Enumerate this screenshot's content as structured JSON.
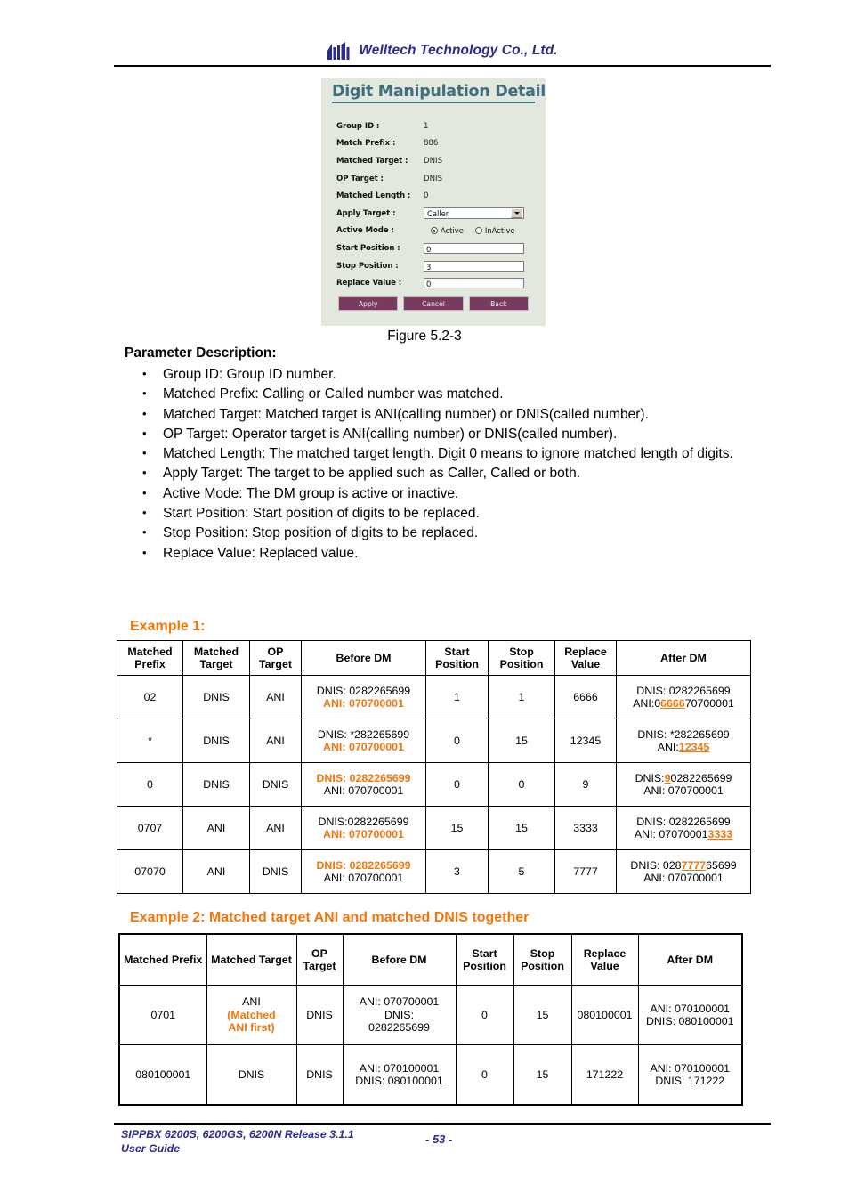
{
  "header": {
    "company": "Welltech Technology Co., Ltd.",
    "logo_icon": "welltech-logo-icon"
  },
  "panel": {
    "title": "Digit Manipulation Detail",
    "fields": [
      {
        "label": "Group ID :",
        "value": "1",
        "type": "static"
      },
      {
        "label": "Match Prefix :",
        "value": "886",
        "type": "static"
      },
      {
        "label": "Matched Target :",
        "value": "DNIS",
        "type": "static"
      },
      {
        "label": "OP Target :",
        "value": "DNIS",
        "type": "static"
      },
      {
        "label": "Matched Length :",
        "value": "0",
        "type": "static"
      }
    ],
    "apply_target": {
      "label": "Apply Target :",
      "value": "Caller"
    },
    "active_mode": {
      "label": "Active Mode :",
      "option_active": "Active",
      "option_inactive": "InActive",
      "selected": "Active"
    },
    "start_position": {
      "label": "Start Position :",
      "value": "0"
    },
    "stop_position": {
      "label": "Stop Position :",
      "value": "3"
    },
    "replace_value": {
      "label": "Replace Value :",
      "value": "0"
    },
    "buttons": {
      "apply": "Apply",
      "cancel": "Cancel",
      "back": "Back"
    },
    "colors": {
      "background": "#e2e8dd",
      "title": "#3f6f7c",
      "button": "#7a3a5f"
    }
  },
  "figure": {
    "caption": "Figure 5.2-3"
  },
  "parameters": {
    "heading": "Parameter Description:",
    "items": [
      "Group ID: Group ID number.",
      "Matched Prefix: Calling or Called number was matched.",
      "Matched Target: Matched target is ANI(calling number) or DNIS(called number).",
      "OP Target: Operator target is ANI(calling number) or DNIS(called number).",
      "Matched Length: The matched target length. Digit 0 means to ignore matched length of digits.",
      "Apply Target: The target to be applied such as Caller, Called or both.",
      "Active Mode: The DM group is active or inactive.",
      "Start Position: Start position of digits to be replaced.",
      "Stop Position: Stop position of digits to be replaced.",
      "Replace Value: Replaced value."
    ]
  },
  "example1": {
    "heading": "Example 1:",
    "accent_color": "#f4760a",
    "columns": [
      "Matched Prefix",
      "Matched Target",
      "OP Target",
      "Before DM",
      "Start Position",
      "Stop Position",
      "Replace Value",
      "After DM"
    ],
    "rows": [
      {
        "matched_prefix": "02",
        "matched_target": "DNIS",
        "op_target": "ANI",
        "before_dm": {
          "line1": "DNIS: 0282265699",
          "line2": "ANI: 070700001",
          "highlight": "line2"
        },
        "start_position": "1",
        "stop_position": "1",
        "replace_value": "6666",
        "after_dm": {
          "line1": "DNIS: 0282265699",
          "line2_pre": "ANI:0",
          "line2_hl": "6666",
          "line2_post": "70700001"
        }
      },
      {
        "matched_prefix": "*",
        "matched_target": "DNIS",
        "op_target": "ANI",
        "before_dm": {
          "line1": "DNIS: *282265699",
          "line2": "ANI: 070700001",
          "highlight": "line2"
        },
        "start_position": "0",
        "stop_position": "15",
        "replace_value": "12345",
        "after_dm": {
          "line1": "DNIS: *282265699",
          "line2_pre": "ANI:",
          "line2_hl": "12345",
          "line2_post": ""
        }
      },
      {
        "matched_prefix": "0",
        "matched_target": "DNIS",
        "op_target": "DNIS",
        "before_dm": {
          "line1": "DNIS: 0282265699",
          "line2": "ANI: 070700001",
          "highlight": "line1"
        },
        "start_position": "0",
        "stop_position": "0",
        "replace_value": "9",
        "after_dm": {
          "line1_pre": "DNIS:",
          "line1_hl": "9",
          "line1_post": "0282265699",
          "line2": "ANI: 070700001"
        }
      },
      {
        "matched_prefix": "0707",
        "matched_target": "ANI",
        "op_target": "ANI",
        "before_dm": {
          "line1": "DNIS:0282265699",
          "line2": "ANI: 070700001",
          "highlight": "line2"
        },
        "start_position": "15",
        "stop_position": "15",
        "replace_value": "3333",
        "after_dm": {
          "line1": "DNIS: 0282265699",
          "line2_pre": "ANI: 07070001",
          "line2_hl": "3333",
          "line2_post": ""
        }
      },
      {
        "matched_prefix": "07070",
        "matched_target": "ANI",
        "op_target": "DNIS",
        "before_dm": {
          "line1": "DNIS: 0282265699",
          "line2": "ANI: 070700001",
          "highlight": "line1"
        },
        "start_position": "3",
        "stop_position": "5",
        "replace_value": "7777",
        "after_dm": {
          "line1_pre": "DNIS: 028",
          "line1_hl": "7777",
          "line1_post": "65699",
          "line2": "ANI: 070700001"
        }
      }
    ]
  },
  "example2": {
    "heading": "Example 2: Matched target ANI and matched DNIS together",
    "columns": [
      "Matched Prefix",
      "Matched Target",
      "OP Target",
      "Before DM",
      "Start Position",
      "Stop Position",
      "Replace Value",
      "After DM"
    ],
    "rows": [
      {
        "matched_prefix": "0701",
        "matched_target": {
          "main": "ANI",
          "note_line1": "(Matched",
          "note_line2": "ANI first)"
        },
        "op_target": "DNIS",
        "before_dm": {
          "line1": "ANI: 070700001",
          "line2": "DNIS:",
          "line3": "0282265699"
        },
        "start_position": "0",
        "stop_position": "15",
        "replace_value": "080100001",
        "after_dm": {
          "line1": "ANI: 070100001",
          "line2": "DNIS: 080100001"
        }
      },
      {
        "matched_prefix": "080100001",
        "matched_target": {
          "main": "DNIS"
        },
        "op_target": "DNIS",
        "before_dm": {
          "line1": "ANI: 070100001",
          "line2": "DNIS: 080100001"
        },
        "start_position": "0",
        "stop_position": "15",
        "replace_value": "171222",
        "after_dm": {
          "line1": "ANI: 070100001",
          "line2": "DNIS: 171222"
        }
      }
    ]
  },
  "footer": {
    "product_line": "SIPPBX 6200S, 6200GS, 6200N    Release 3.1.1",
    "doc_line": "User Guide",
    "page": "- 53 -"
  }
}
